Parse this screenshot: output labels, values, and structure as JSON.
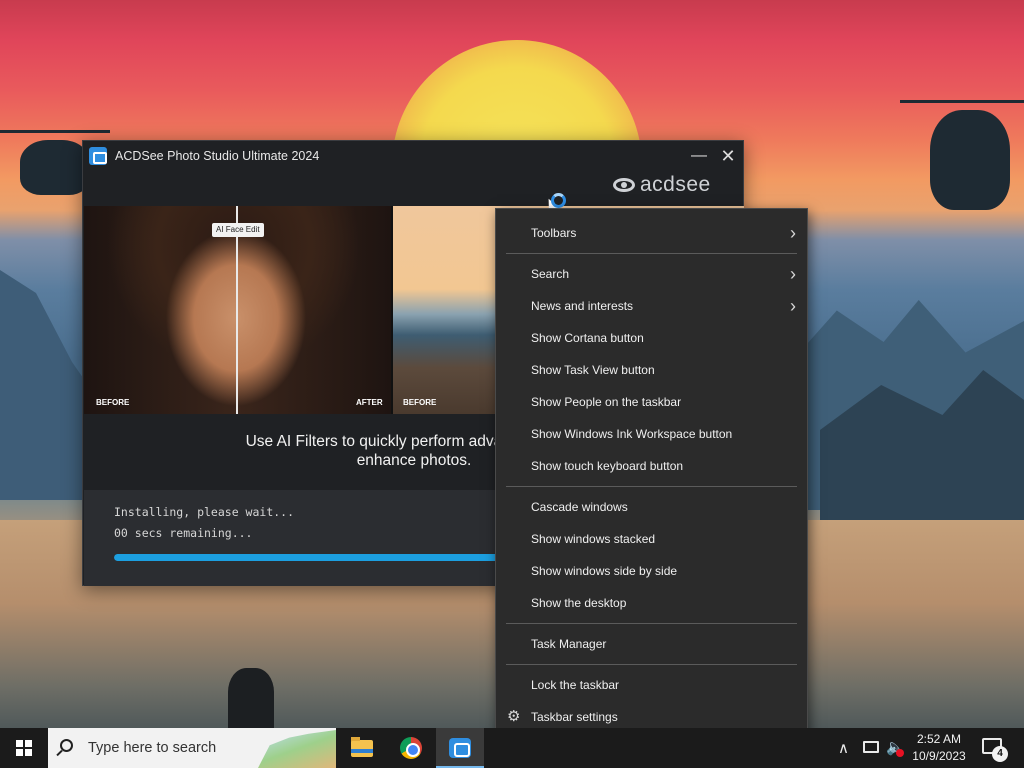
{
  "installer": {
    "title": "ACDSee Photo Studio Ultimate 2024",
    "brand": "acdsee",
    "minimize_glyph": "—",
    "close_glyph": "✕",
    "hero": {
      "badge": "AI Face Edit",
      "tag_before_1": "BEFORE",
      "tag_after_1": "AFTER",
      "tag_before_2": "BEFORE"
    },
    "caption_line1": "Use AI Filters to quickly perform advanced image",
    "caption_line2": "enhance photos.",
    "status_line1": "Installing, please wait...",
    "status_line2": "00 secs remaining...",
    "progress_fraction": 0.97,
    "accent_color": "#1c9fe0"
  },
  "context_menu": {
    "items": [
      {
        "label": "Toolbars",
        "submenu": true
      },
      {
        "label": "Search",
        "submenu": true
      },
      {
        "label": "News and interests",
        "submenu": true
      },
      {
        "label": "Show Cortana button",
        "submenu": false
      },
      {
        "label": "Show Task View button",
        "submenu": false
      },
      {
        "label": "Show People on the taskbar",
        "submenu": false
      },
      {
        "label": "Show Windows Ink Workspace button",
        "submenu": false
      },
      {
        "label": "Show touch keyboard button",
        "submenu": false
      },
      {
        "label": "Cascade windows",
        "submenu": false
      },
      {
        "label": "Show windows stacked",
        "submenu": false
      },
      {
        "label": "Show windows side by side",
        "submenu": false
      },
      {
        "label": "Show the desktop",
        "submenu": false
      },
      {
        "label": "Task Manager",
        "submenu": false
      },
      {
        "label": "Lock the taskbar",
        "submenu": false
      },
      {
        "label": "Taskbar settings",
        "submenu": false,
        "icon": "gear-icon"
      }
    ],
    "submenu_glyph": "›",
    "gear_glyph": "⚙"
  },
  "taskbar": {
    "search_placeholder": "Type here to search",
    "apps": [
      "file-explorer-icon",
      "chrome-icon",
      "acdsee-icon"
    ],
    "tray_chevron": "∧",
    "volume_glyph": "🔈",
    "time": "2:52 AM",
    "date": "10/9/2023",
    "notification_count": "4"
  }
}
